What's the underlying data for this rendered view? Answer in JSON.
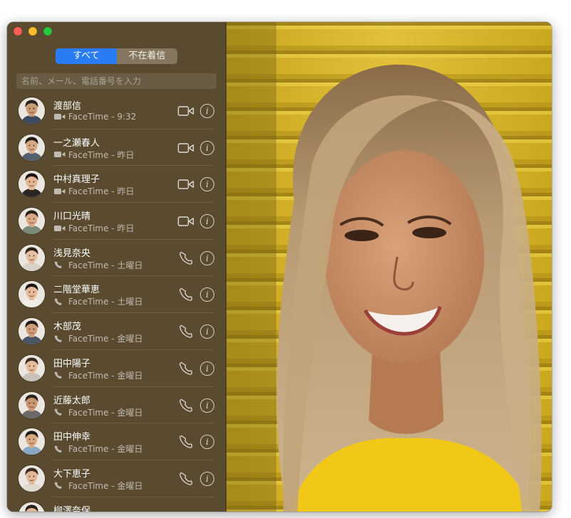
{
  "tabs": {
    "all": "すべて",
    "missed": "不在着信"
  },
  "search": {
    "placeholder": "名前、メール、電話番号を入力",
    "value": ""
  },
  "colors": {
    "accent": "#2a7cf5",
    "sidebar": "#594a30",
    "close": "#fe5f57",
    "minimize": "#febc2e",
    "zoom": "#28c840"
  },
  "calls": [
    {
      "name": "渡部信",
      "detail": "FaceTime - 9:32",
      "type": "video",
      "type_icon": "video-camera-icon",
      "action_icon": "video-call-icon",
      "skin": "#c99a74",
      "hair": "#2a221c",
      "shirt": "#3b4a5e"
    },
    {
      "name": "一之瀬春人",
      "detail": "FaceTime - 昨日",
      "type": "video",
      "type_icon": "video-camera-icon",
      "action_icon": "video-call-icon",
      "skin": "#d6a783",
      "hair": "#1d1a18",
      "shirt": "#556070"
    },
    {
      "name": "中村真理子",
      "detail": "FaceTime - 昨日",
      "type": "video",
      "type_icon": "video-camera-icon",
      "action_icon": "video-call-icon",
      "skin": "#e2b694",
      "hair": "#1c1410",
      "shirt": "#2b2523"
    },
    {
      "name": "川口光晴",
      "detail": "FaceTime - 昨日",
      "type": "video",
      "type_icon": "video-camera-icon",
      "action_icon": "video-call-icon",
      "skin": "#d9a985",
      "hair": "#2a221b",
      "shirt": "#7a8a7a"
    },
    {
      "name": "浅見奈央",
      "detail": "FaceTime - 土曜日",
      "type": "audio",
      "type_icon": "phone-icon",
      "action_icon": "phone-call-icon",
      "skin": "#e8bea0",
      "hair": "#2d2019",
      "shirt": "#d8d2c8"
    },
    {
      "name": "二階堂華恵",
      "detail": "FaceTime - 土曜日",
      "type": "audio",
      "type_icon": "phone-icon",
      "action_icon": "phone-call-icon",
      "skin": "#e5b999",
      "hair": "#1d1612",
      "shirt": "#f0ece6"
    },
    {
      "name": "木部茂",
      "detail": "FaceTime - 金曜日",
      "type": "audio",
      "type_icon": "phone-icon",
      "action_icon": "phone-call-icon",
      "skin": "#cf9c77",
      "hair": "#201a16",
      "shirt": "#4a5566"
    },
    {
      "name": "田中陽子",
      "detail": "FaceTime - 金曜日",
      "type": "audio",
      "type_icon": "phone-icon",
      "action_icon": "phone-call-icon",
      "skin": "#e6bb9c",
      "hair": "#3a2a20",
      "shirt": "#c8c2ba"
    },
    {
      "name": "近藤太郎",
      "detail": "FaceTime - 金曜日",
      "type": "audio",
      "type_icon": "phone-icon",
      "action_icon": "phone-call-icon",
      "skin": "#c89570",
      "hair": "#2c241d",
      "shirt": "#6a6a6a"
    },
    {
      "name": "田中伸幸",
      "detail": "FaceTime - 金曜日",
      "type": "audio",
      "type_icon": "phone-icon",
      "action_icon": "phone-call-icon",
      "skin": "#d8a883",
      "hair": "#1f1a16",
      "shirt": "#8aa7c4"
    },
    {
      "name": "大下恵子",
      "detail": "FaceTime - 金曜日",
      "type": "audio",
      "type_icon": "phone-icon",
      "action_icon": "phone-call-icon",
      "skin": "#e4b797",
      "hair": "#3b2b20",
      "shirt": "#e0dad0"
    },
    {
      "name": "柳澤奈保",
      "detail": "",
      "type": "audio",
      "type_icon": "phone-icon",
      "action_icon": "phone-call-icon",
      "skin": "#e2b696",
      "hair": "#2a1f18",
      "shirt": "#d0cac2"
    }
  ]
}
